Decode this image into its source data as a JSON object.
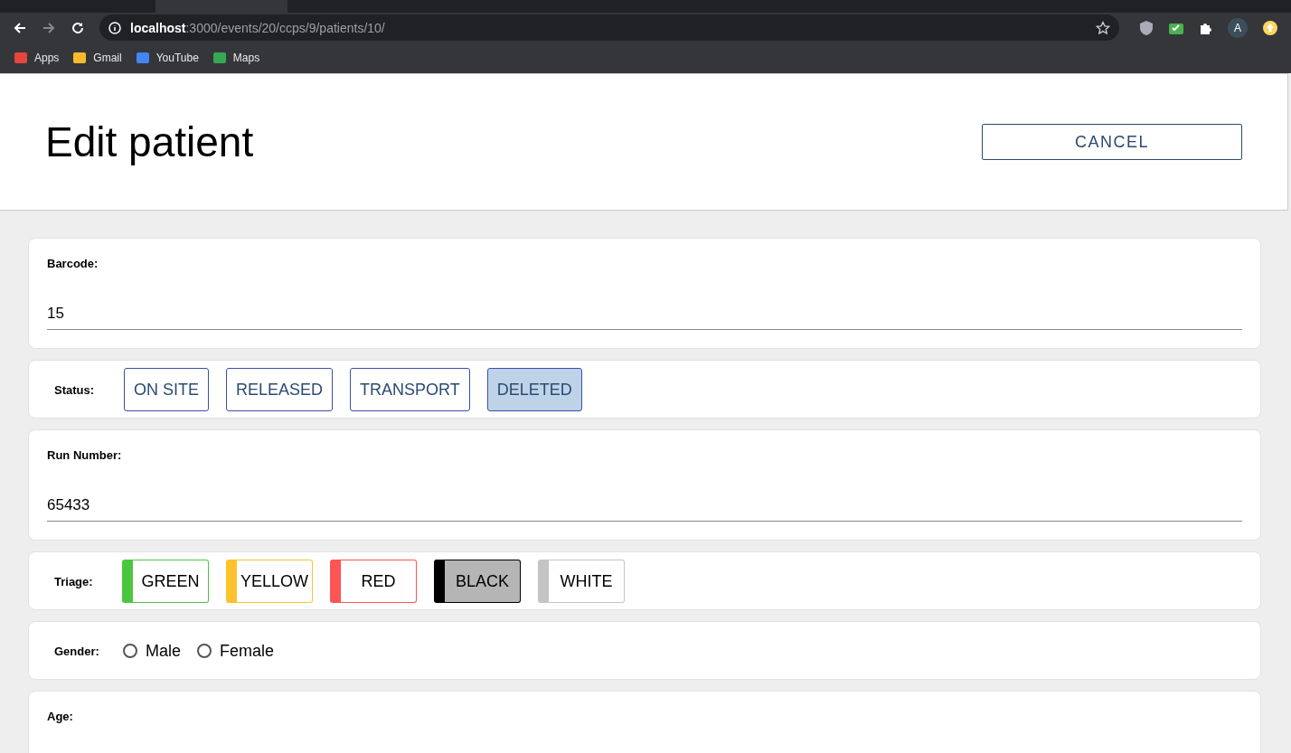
{
  "browser": {
    "url_host": "localhost",
    "url_path": ":3000/events/20/ccps/9/patients/10/",
    "bookmarks": [
      "Apps",
      "Gmail",
      "YouTube",
      "Maps"
    ],
    "profile_initial": "A"
  },
  "header": {
    "title": "Edit patient",
    "cancel": "CANCEL"
  },
  "barcode": {
    "label": "Barcode:",
    "value": "15"
  },
  "status": {
    "label": "Status:",
    "options": [
      {
        "label": "ON SITE",
        "selected": false
      },
      {
        "label": "RELEASED",
        "selected": false
      },
      {
        "label": "TRANSPORT",
        "selected": false
      },
      {
        "label": "DELETED",
        "selected": true
      }
    ]
  },
  "run_number": {
    "label": "Run Number:",
    "value": "65433"
  },
  "triage": {
    "label": "Triage:",
    "options": [
      {
        "label": "GREEN",
        "color": "#4bc73f",
        "selected": false
      },
      {
        "label": "YELLOW",
        "color": "#fdc22c",
        "selected": false
      },
      {
        "label": "RED",
        "color": "#fd5454",
        "selected": false
      },
      {
        "label": "BLACK",
        "color": "#000000",
        "selected": true
      },
      {
        "label": "WHITE",
        "color": "#c4c4c4",
        "selected": false
      }
    ]
  },
  "gender": {
    "label": "Gender:",
    "options": [
      {
        "label": "Male",
        "selected": false
      },
      {
        "label": "Female",
        "selected": false
      }
    ]
  },
  "age": {
    "label": "Age:"
  }
}
